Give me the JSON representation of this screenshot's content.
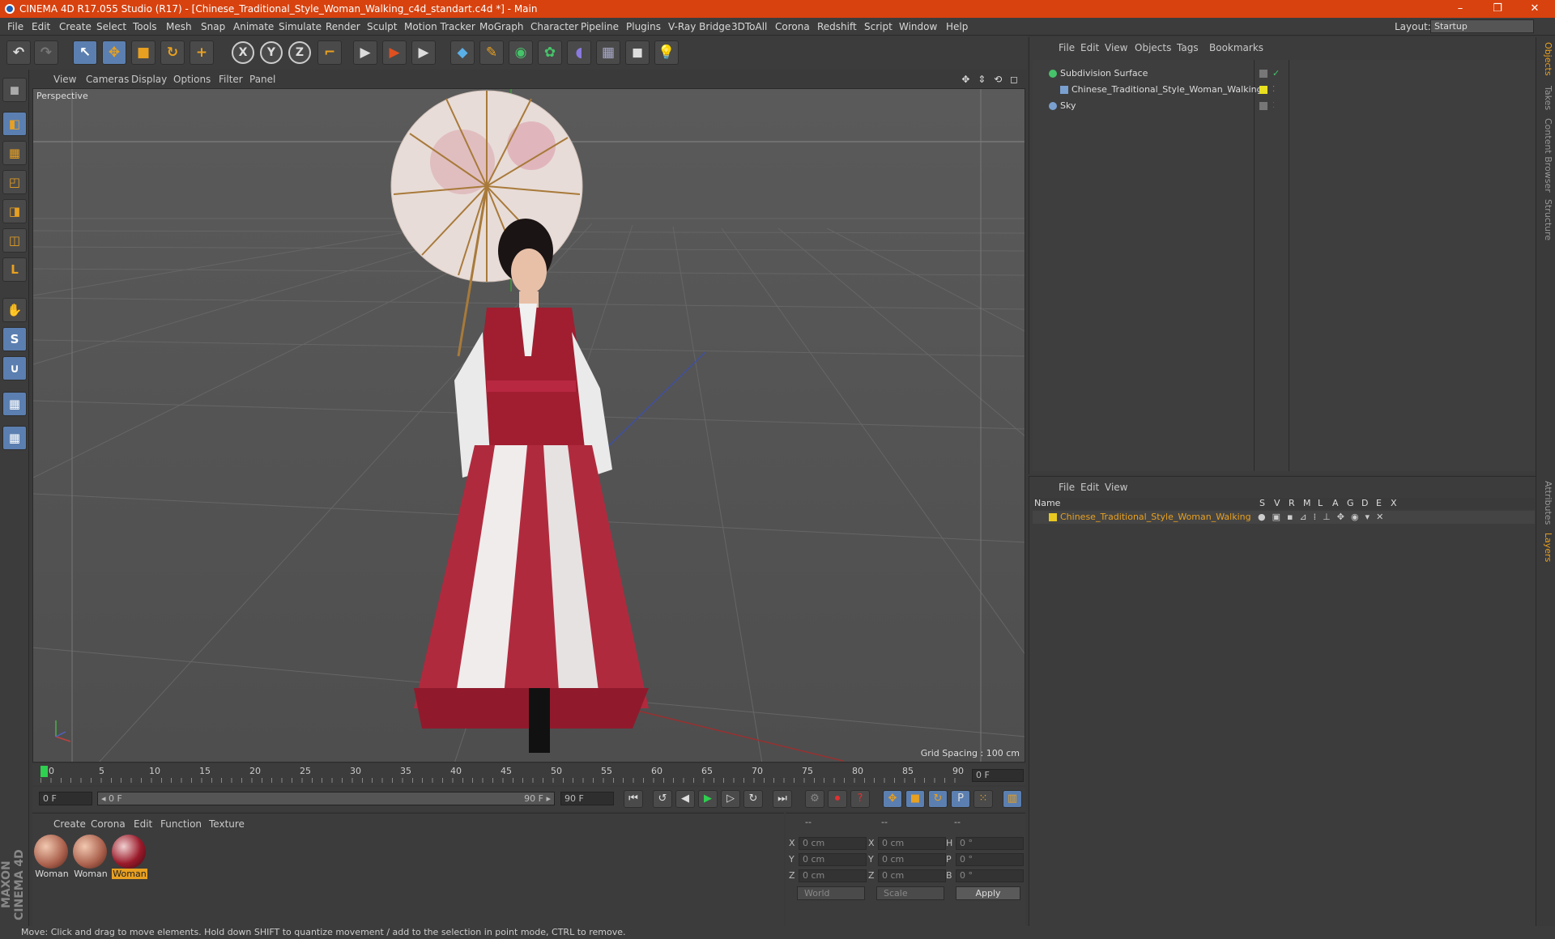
{
  "titlebar": {
    "title": "CINEMA 4D R17.055 Studio (R17) - [Chinese_Traditional_Style_Woman_Walking_c4d_standart.c4d *] - Main",
    "minimize": "–",
    "maximize": "❐",
    "close": "✕"
  },
  "menu": [
    "File",
    "Edit",
    "Create",
    "Select",
    "Tools",
    "Mesh",
    "Snap",
    "Animate",
    "Simulate",
    "Render",
    "Sculpt",
    "Motion Tracker",
    "MoGraph",
    "Character",
    "Pipeline",
    "Plugins",
    "V-Ray Bridge",
    "3DToAll",
    "Corona",
    "Redshift",
    "Script",
    "Window",
    "Help"
  ],
  "layout": {
    "label": "Layout:",
    "value": "Startup"
  },
  "toolbar": {
    "undo": "↶",
    "redo": "↷",
    "select": "↖",
    "move": "✥",
    "scale": "■",
    "rotate": "↻",
    "add": "+",
    "x": "X",
    "y": "Y",
    "z": "Z",
    "coord": "⌐",
    "render1": "▶",
    "render2": "▶",
    "render3": "▶",
    "cube": "◆",
    "pen": "✎",
    "nurbs": "◉",
    "array": "✿",
    "deform": "◖",
    "floor": "▦",
    "camera": "◼",
    "light": "💡"
  },
  "lefttools": [
    "◼",
    "◧",
    "▦",
    "◰",
    "◨",
    "◫",
    "L",
    "✋",
    "S",
    "∪",
    "▦",
    "▦"
  ],
  "viewport": {
    "menu": [
      "View",
      "Cameras",
      "Display",
      "Options",
      "Filter",
      "Panel"
    ],
    "nav_icons": "✥ ⇕ ⟲ ◻",
    "label": "Perspective",
    "grid_spacing": "Grid Spacing : 100 cm"
  },
  "timeline": {
    "ticks": [
      "0",
      "5",
      "10",
      "15",
      "20",
      "25",
      "30",
      "35",
      "40",
      "45",
      "50",
      "55",
      "60",
      "65",
      "70",
      "75",
      "80",
      "85",
      "90"
    ],
    "frame": "0 F"
  },
  "playbar": {
    "start": "0 F",
    "slider_start": "◂ 0 F",
    "slider_end": "90 F ▸",
    "end": "90 F",
    "buttons": [
      "⏮",
      "↺",
      "◀",
      "▶",
      "▷",
      "↻",
      "⏭",
      "⚙",
      "⏺",
      "?",
      "✥",
      "■",
      "↻",
      "P",
      "⁙",
      "▥"
    ]
  },
  "materials": {
    "menu": [
      "Create",
      "Corona",
      "Edit",
      "Function",
      "Texture"
    ],
    "items": [
      {
        "label": "Woman",
        "selected": false
      },
      {
        "label": "Woman",
        "selected": false
      },
      {
        "label": "Woman",
        "selected": true
      }
    ]
  },
  "coords": {
    "headers": [
      "--",
      "--",
      "--"
    ],
    "rows": [
      {
        "a": "X",
        "av": "0 cm",
        "b": "X",
        "bv": "0 cm",
        "c": "H",
        "cv": "0 °"
      },
      {
        "a": "Y",
        "av": "0 cm",
        "b": "Y",
        "bv": "0 cm",
        "c": "P",
        "cv": "0 °"
      },
      {
        "a": "Z",
        "av": "0 cm",
        "b": "Z",
        "bv": "0 cm",
        "c": "B",
        "cv": "0 °"
      }
    ],
    "world": "World",
    "scale": "Scale",
    "apply": "Apply"
  },
  "objects": {
    "menu": [
      "File",
      "Edit",
      "View",
      "Objects",
      "Tags",
      "Bookmarks"
    ],
    "rows": [
      {
        "name": "Subdivision Surface",
        "color": "#46c46a"
      },
      {
        "name": "Chinese_Traditional_Style_Woman_Walking",
        "color": "#7aa0d0"
      },
      {
        "name": "Sky",
        "color": "#7aa0d0"
      }
    ]
  },
  "layers": {
    "menu": [
      "File",
      "Edit",
      "View"
    ],
    "headers": [
      "Name",
      "S",
      "V",
      "R",
      "M",
      "L",
      "A",
      "G",
      "D",
      "E",
      "X"
    ],
    "row": "Chinese_Traditional_Style_Woman_Walking",
    "layer_color": "#e8c820"
  },
  "rightstrip": [
    {
      "label": "Objects",
      "active": true
    },
    {
      "label": "Takes",
      "active": false
    },
    {
      "label": "Content Browser",
      "active": false
    },
    {
      "label": "Structure",
      "active": false
    },
    {
      "label": "Attributes",
      "active": false
    },
    {
      "label": "Layers",
      "active": true
    }
  ],
  "statusbar": "Move: Click and drag to move elements. Hold down SHIFT to quantize movement / add to the selection in point mode, CTRL to remove.",
  "maxon": "MAXON CINEMA 4D"
}
